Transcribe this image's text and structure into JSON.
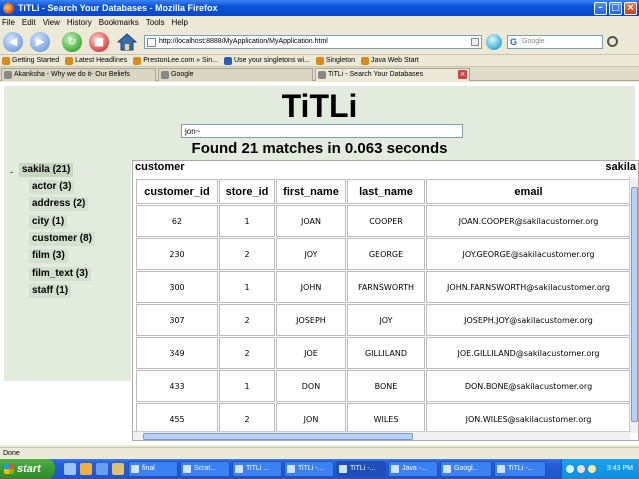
{
  "window": {
    "title": "TiTLi - Search Your Databases - Mozilla Firefox"
  },
  "menu": [
    "File",
    "Edit",
    "View",
    "History",
    "Bookmarks",
    "Tools",
    "Help"
  ],
  "nav": {
    "url": "http://localhost:8888/MyApplication/MyApplication.html",
    "search_placeholder": "Google",
    "search_logo": "G"
  },
  "bookmarks": [
    "Getting Started",
    "Latest Headlines",
    "PrestonLee.com » Sin...",
    "Use your singletons wi...",
    "Singleton",
    "Java Web Start"
  ],
  "tabs": [
    {
      "label": "Akanksha - Why we do it- Our Beliefs"
    },
    {
      "label": "Google"
    },
    {
      "label": "TiTLi - Search Your Databases"
    }
  ],
  "app": {
    "title": "TiTLi",
    "query": "jon~",
    "summary": "Found 21 matches in 0.063 seconds"
  },
  "tree": {
    "toggle": "-",
    "root": "sakila (21)",
    "items": [
      "actor (3)",
      "address (2)",
      "city (1)",
      "customer (8)",
      "film (3)",
      "film_text (3)",
      "staff (1)"
    ]
  },
  "results": {
    "table_name": "customer",
    "db_name_right": "sakila",
    "columns": [
      "customer_id",
      "store_id",
      "first_name",
      "last_name",
      "email"
    ],
    "rows": [
      [
        "62",
        "1",
        "JOAN",
        "COOPER",
        "JOAN.COOPER@sakilacustomer.org"
      ],
      [
        "230",
        "2",
        "JOY",
        "GEORGE",
        "JOY.GEORGE@sakilacustomer.org"
      ],
      [
        "300",
        "1",
        "JOHN",
        "FARNSWORTH",
        "JOHN.FARNSWORTH@sakilacustomer.org"
      ],
      [
        "307",
        "2",
        "JOSEPH",
        "JOY",
        "JOSEPH.JOY@sakilacustomer.org"
      ],
      [
        "349",
        "2",
        "JOE",
        "GILLILAND",
        "JOE.GILLILAND@sakilacustomer.org"
      ],
      [
        "433",
        "1",
        "DON",
        "BONE",
        "DON.BONE@sakilacustomer.org"
      ],
      [
        "455",
        "2",
        "JON",
        "WILES",
        "JON.WILES@sakilacustomer.org"
      ]
    ]
  },
  "status": "Done",
  "taskbar": {
    "start": "start",
    "items": [
      "final",
      "Scrat...",
      "TiTLi ...",
      "TiTLi -...",
      "TiTLi -...",
      "Java -...",
      "Googl...",
      "TiTLi -..."
    ],
    "clock": "3:43 PM"
  },
  "colors": {
    "panel_bg": "#e3ebdf",
    "tree_highlight": "#c7d8c1",
    "titlebar": "#0a52d8",
    "taskbar": "#245edb"
  }
}
